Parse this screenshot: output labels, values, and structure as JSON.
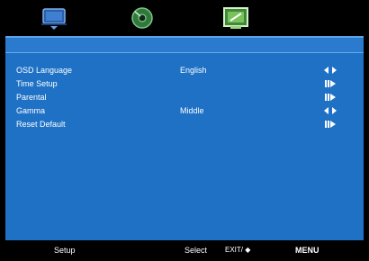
{
  "tabs": [
    {
      "icon": "tv-icon"
    },
    {
      "icon": "disc-icon"
    },
    {
      "icon": "setup-screen-icon"
    }
  ],
  "menu": {
    "items": [
      {
        "label": "OSD Language",
        "value": "English",
        "arrow": "left-right-arrow-icon"
      },
      {
        "label": "Time Setup",
        "value": "",
        "arrow": "enter-arrow-icon"
      },
      {
        "label": "Parental",
        "value": "",
        "arrow": "enter-arrow-icon"
      },
      {
        "label": "Gamma",
        "value": "Middle",
        "arrow": "left-right-arrow-icon"
      },
      {
        "label": "Reset Default",
        "value": "",
        "arrow": "enter-arrow-icon"
      }
    ]
  },
  "footer": {
    "section": "Setup",
    "select": "Select",
    "exit": "EXIT/ ◆",
    "menu": "MENU"
  },
  "colors": {
    "panel": "#1f71c5",
    "background": "#000000",
    "text": "#ffffff"
  }
}
